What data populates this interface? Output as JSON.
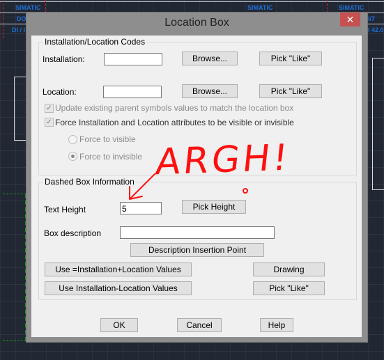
{
  "background": {
    "labels": [
      "SIMATIC",
      "SIMATIC",
      "SIMATIC",
      "DOC",
      "DI / I",
      "I/7",
      "I 42.0"
    ]
  },
  "dialog": {
    "title": "Location Box",
    "close_icon": "close-icon",
    "install_group": {
      "label": "Installation/Location Codes",
      "installation_label": "Installation:",
      "installation_value": "",
      "location_label": "Location:",
      "location_value": "",
      "browse": "Browse...",
      "pick_like": "Pick \"Like\"",
      "update_parent": {
        "label": "Update existing parent symbols values to match the location box",
        "checked": true
      },
      "force_attr": {
        "label": "Force Installation and Location attributes to be visible or invisible",
        "checked": true
      },
      "force_visible": "Force to visible",
      "force_invisible": "Force to invisible",
      "selected_radio": "Force to invisible"
    },
    "dashed_group": {
      "label": "Dashed Box Information",
      "text_height_label": "Text Height",
      "text_height_value": "5",
      "pick_height": "Pick Height",
      "box_desc_label": "Box description",
      "box_desc_value": "",
      "desc_insertion": "Description Insertion Point",
      "use_plus": "Use =Installation+Location Values",
      "use_minus": "Use Installation-Location Values",
      "drawing": "Drawing",
      "pick_like": "Pick \"Like\""
    },
    "ok": "OK",
    "cancel": "Cancel",
    "help": "Help"
  },
  "annotation": {
    "text": "ARGH!",
    "color": "#ff0000"
  }
}
